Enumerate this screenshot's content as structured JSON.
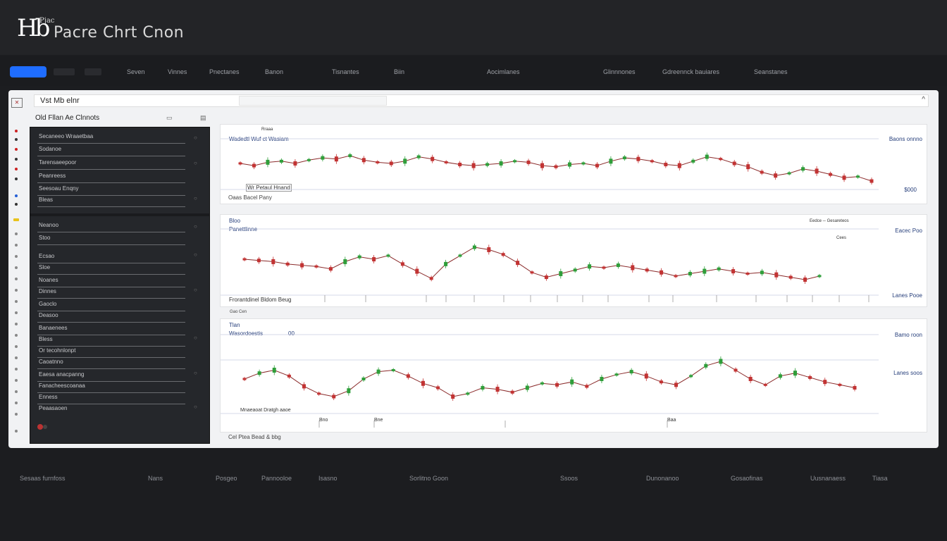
{
  "app": {
    "logo_mark": "Hb",
    "logo_small": "Pjac",
    "title": "Pacre Chrt Cnon"
  },
  "nav": {
    "items": [
      "Seven",
      "Vinnes",
      "Pnectanes",
      "Banon",
      "Tisnantes",
      "Biin",
      "Aocimlanes",
      "Glinnnones",
      "Gdreennck bauiares",
      "Seanstanes"
    ]
  },
  "toolbar": {
    "panel_button_icon": "close-icon",
    "title": "Vst Mb elnr",
    "right_control": "^"
  },
  "sidebar": {
    "title": "Old Fllan Ae Clnnots",
    "title_controls": [
      "▭",
      "▤"
    ],
    "items": [
      "Secaneeo Wraaetbaa",
      "Sodanoe",
      "Tarensaeepoor",
      "Peanreess",
      "Seesoau Enqny",
      "Bleas",
      "Neanoo",
      "Stoo",
      "Ecsao",
      "Sloe",
      "Noanes",
      "Dinnes",
      "Gaoclo",
      "Deasoo",
      "Banaenees",
      "Bless",
      "Or tecohnlonpt",
      "Caoatnno",
      "Eaesa anacpanng",
      "Fanacheescoanaa",
      "Enness",
      "Peaasaoen"
    ]
  },
  "charts": [
    {
      "top_note": "Rraaa",
      "title": "Wadedtl Wuf ct Wasiam",
      "price_label": "Baons onnno",
      "bottom_price_label": "$000",
      "inner_label": "Wr Petaul Hnand",
      "caption": "Oaas Bacel Pany",
      "color_up": "#2f9e3a",
      "color_down": "#c23333"
    },
    {
      "top_note": "Bloo",
      "title": "Panettlinne",
      "price_label": "Eacec Poo",
      "bottom_price_label": "Lanes Pooe",
      "legend": "Eedce ─ Gesareteos",
      "legend_value": "Cees",
      "caption_left": "Frorantdinel Bldom Beug",
      "caption_above": "Gao Cen"
    },
    {
      "top_note": "Tlan",
      "title": "Wasordoestis",
      "title_value": "00",
      "price_label": "Bamo roon",
      "mid_price_label": "Lanes soos",
      "caption": "Mnaeaoat Dratgh aaoe",
      "axis_labels": [
        "Bno",
        "Bne",
        "Baa"
      ],
      "caption_below": "Cel Ptea Bead & bbg"
    }
  ],
  "chart_data": [
    {
      "type": "line",
      "series": [
        {
          "values": [
            238,
            240,
            237,
            236,
            238,
            235,
            233,
            234,
            231,
            235,
            237,
            238,
            236,
            232,
            234,
            237,
            239,
            240,
            239,
            238,
            236,
            237,
            240,
            241,
            239,
            238,
            240,
            236,
            233,
            234,
            236,
            239,
            240,
            236,
            232,
            234,
            238,
            241,
            246,
            249,
            247,
            243,
            245,
            248,
            251,
            250,
            254
          ]
        }
      ]
    },
    {
      "type": "line",
      "series": [
        {
          "values": [
            374,
            375,
            376,
            378,
            379,
            380,
            382,
            376,
            372,
            374,
            371,
            378,
            384,
            390,
            378,
            371,
            364,
            366,
            370,
            377,
            385,
            389,
            386,
            383,
            380,
            381,
            379,
            381,
            383,
            385,
            388,
            386,
            384,
            382,
            384,
            386,
            385,
            387,
            389,
            391,
            388
          ]
        }
      ]
    },
    {
      "type": "line",
      "series": [
        {
          "values": [
            542,
            538,
            536,
            540,
            547,
            552,
            554,
            550,
            542,
            537,
            536,
            540,
            545,
            548,
            554,
            552,
            548,
            549,
            551,
            548,
            545,
            546,
            544,
            547,
            542,
            539,
            537,
            540,
            544,
            546,
            540,
            533,
            530,
            536,
            542,
            546,
            540,
            538,
            541,
            544,
            546,
            548
          ]
        }
      ]
    }
  ],
  "footer": {
    "items": [
      "Sesaas furnfoss",
      "Nans",
      "Posgeo",
      "Pannooloe",
      "Isasno",
      "Sorlitno Goon",
      "Ssoos",
      "Dunonanoo",
      "Gosaofinas",
      "Uusnanaess",
      "Tiasa"
    ]
  }
}
